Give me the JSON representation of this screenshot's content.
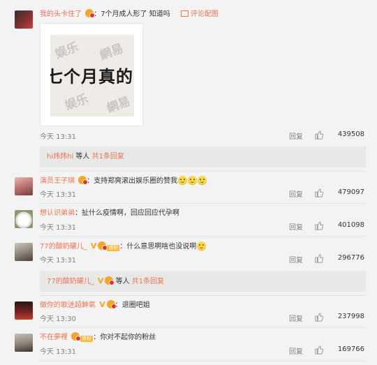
{
  "comments": [
    {
      "username": "我的头卡住了",
      "text": "7个月成人形了 知道吗",
      "pic_link": "评论配图",
      "image_text": "七个月真的",
      "image_watermark_1": "娱乐",
      "image_watermark_2": "網易",
      "time": "今天 13:31",
      "reply": "回复",
      "likes": "439508",
      "subreply": {
        "user": "hi炜炜hi",
        "mid": " 等人 ",
        "more": "共1条回复"
      }
    },
    {
      "username": "演员王子琪",
      "text": "支持郑爽滚出娱乐圈的赞我",
      "time": "今天 13:31",
      "reply": "回复",
      "likes": "479097"
    },
    {
      "username": "想认识弟弟",
      "text": "扯什么疫情啊，回应回应代孕啊",
      "time": "今天 13:31",
      "reply": "回复",
      "likes": "401098"
    },
    {
      "username": "77的酸奶罐儿_",
      "fan_badge": "铁粉",
      "text": "什么意思啊啥也没说啊",
      "time": "今天 13:31",
      "reply": "回复",
      "likes": "296776",
      "subreply": {
        "user": "77的酸奶罐儿_",
        "mid": " 等人 ",
        "more": "共1条回复"
      }
    },
    {
      "username": "做你的歌迷超鉮氣",
      "text": "退圈吧姐",
      "time": "今天 13:30",
      "reply": "回复",
      "likes": "237998"
    },
    {
      "username": "不在夢裡",
      "fan_badge": "铁粉",
      "text": "你对不起你的粉丝",
      "time": "今天 13:31",
      "reply": "回复",
      "likes": "169766"
    }
  ],
  "icons": {
    "avatar": "avatar",
    "like": "thumbs-up-icon",
    "badge": "vip-badge-icon",
    "verified": "verified-v-icon",
    "emoji": "smile-emoji-icon",
    "picture": "image-icon"
  },
  "colors": {
    "username": "#eb7350",
    "meta": "#808080",
    "background": "#f3f3f3"
  }
}
